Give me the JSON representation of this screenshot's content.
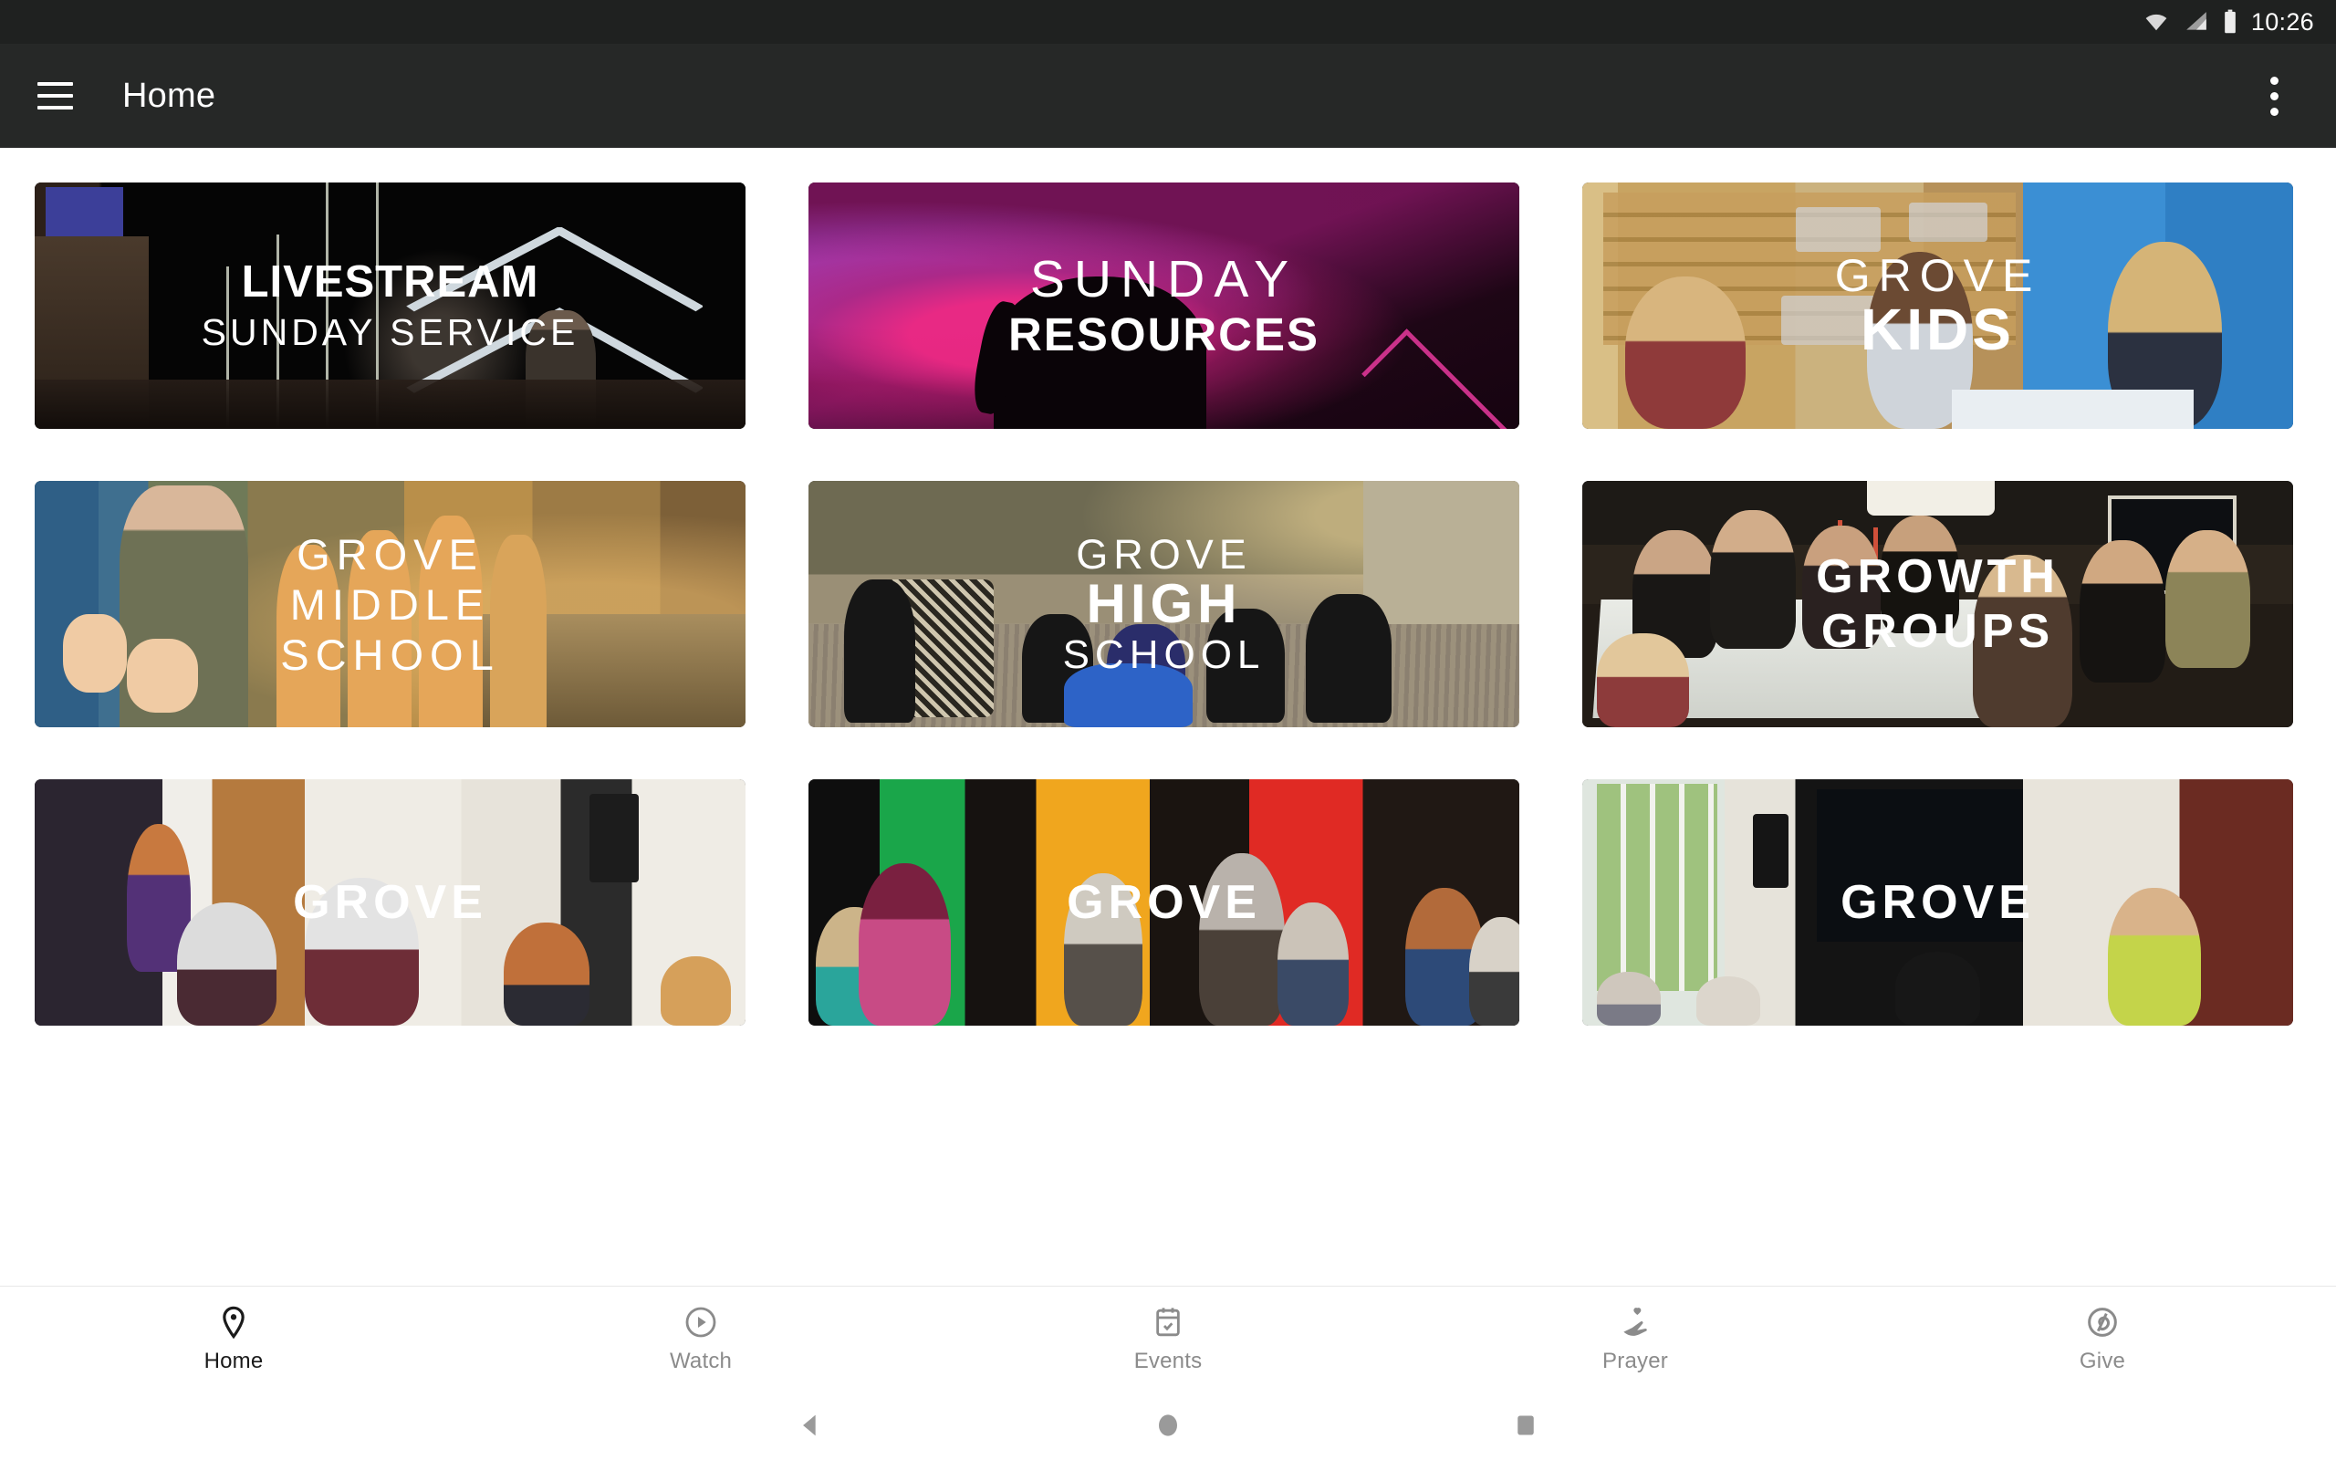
{
  "status_bar": {
    "time": "10:26",
    "icons": [
      "wifi-icon",
      "cellular-signal-icon",
      "battery-icon"
    ]
  },
  "app_bar": {
    "menu_icon": "hamburger-menu-icon",
    "title": "Home",
    "overflow_icon": "overflow-menu-icon",
    "background_color": "#262827",
    "text_color": "#ffffff"
  },
  "cards": [
    {
      "id": "livestream-sunday-service",
      "lines": [
        {
          "text": "LIVESTREAM",
          "style": "bold",
          "size": 49,
          "spacing": 1
        },
        {
          "text": "SUNDAY SERVICE",
          "style": "reg",
          "size": 41,
          "spacing": 4
        }
      ]
    },
    {
      "id": "sunday-resources",
      "lines": [
        {
          "text": "SUNDAY",
          "style": "light",
          "size": 57,
          "spacing": 10
        },
        {
          "text": "RESOURCES",
          "style": "bold",
          "size": 51,
          "spacing": 2
        }
      ]
    },
    {
      "id": "grove-kids",
      "lines": [
        {
          "text": "GROVE",
          "style": "light",
          "size": 50,
          "spacing": 9
        },
        {
          "text": "KIDS",
          "style": "bold",
          "size": 64,
          "spacing": 4
        }
      ]
    },
    {
      "id": "grove-middle-school",
      "lines": [
        {
          "text": "GROVE",
          "style": "reg",
          "size": 47,
          "spacing": 7
        },
        {
          "text": "MIDDLE",
          "style": "reg",
          "size": 47,
          "spacing": 7
        },
        {
          "text": "SCHOOL",
          "style": "reg",
          "size": 47,
          "spacing": 7
        }
      ]
    },
    {
      "id": "grove-high-school",
      "lines": [
        {
          "text": "GROVE",
          "style": "reg",
          "size": 45,
          "spacing": 6
        },
        {
          "text": "HIGH",
          "style": "bold",
          "size": 60,
          "spacing": 5
        },
        {
          "text": "SCHOOL",
          "style": "reg",
          "size": 44,
          "spacing": 6
        }
      ]
    },
    {
      "id": "growth-groups",
      "lines": [
        {
          "text": "GROWTH",
          "style": "bold",
          "size": 52,
          "spacing": 5
        },
        {
          "text": "GROUPS",
          "style": "bold",
          "size": 52,
          "spacing": 5
        }
      ]
    },
    {
      "id": "grove-seniors-teaching",
      "lines": [
        {
          "text": "GROVE",
          "style": "bold",
          "size": 52,
          "spacing": 5
        }
      ]
    },
    {
      "id": "grove-seniors-fellowship",
      "lines": [
        {
          "text": "GROVE",
          "style": "bold",
          "size": 52,
          "spacing": 5
        }
      ]
    },
    {
      "id": "grove-seniors-class",
      "lines": [
        {
          "text": "GROVE",
          "style": "bold",
          "size": 52,
          "spacing": 5
        }
      ]
    }
  ],
  "bottom_nav": {
    "active": "Home",
    "active_color": "#1b1b1b",
    "inactive_color": "#8b8b8b",
    "items": [
      {
        "label": "Home",
        "icon": "location-pin-icon"
      },
      {
        "label": "Watch",
        "icon": "play-circle-icon"
      },
      {
        "label": "Events",
        "icon": "calendar-check-icon"
      },
      {
        "label": "Prayer",
        "icon": "praying-hands-heart-icon"
      },
      {
        "label": "Give",
        "icon": "giving-hand-circle-icon"
      }
    ]
  },
  "system_nav": {
    "buttons": [
      {
        "name": "back",
        "icon": "triangle-back-icon"
      },
      {
        "name": "home",
        "icon": "circle-home-icon"
      },
      {
        "name": "recents",
        "icon": "square-recents-icon"
      }
    ],
    "color": "#9a9a9a"
  }
}
